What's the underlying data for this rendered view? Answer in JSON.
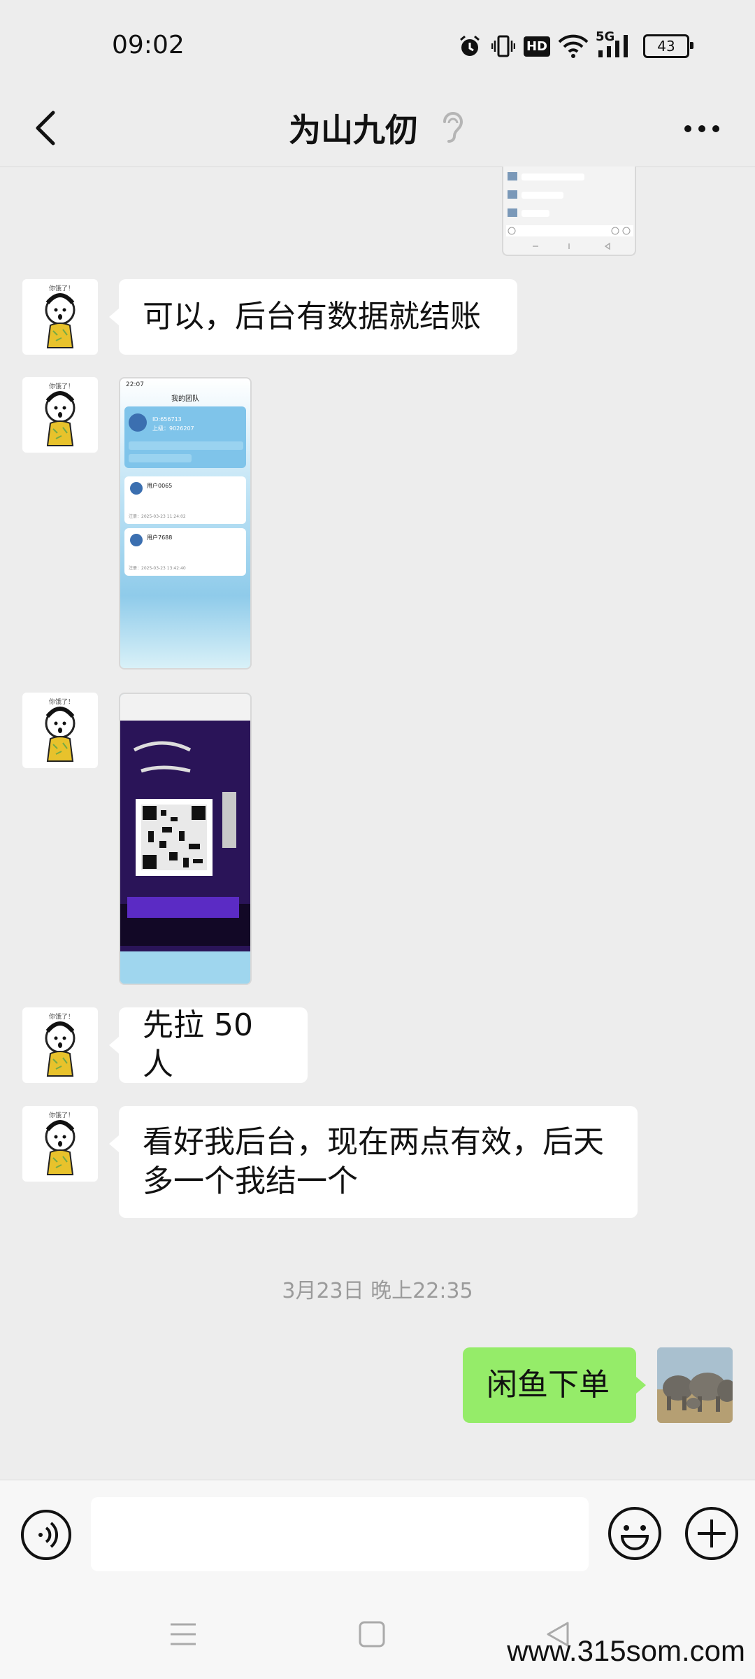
{
  "status_bar": {
    "time": "09:02",
    "network": "5G",
    "hd": "HD",
    "battery": "43",
    "icons": [
      "alarm-icon",
      "vibrate-icon",
      "hd-icon",
      "wifi-icon",
      "signal-icon",
      "battery-icon"
    ]
  },
  "header": {
    "title": "为山九仞",
    "back_icon": "chevron-left-icon",
    "muted_icon": "ear-icon",
    "more_icon": "more-dots-icon"
  },
  "messages": [
    {
      "side": "left",
      "type": "text",
      "text": "可以，后台有数据就结账"
    },
    {
      "side": "left",
      "type": "image",
      "content": "team-screenshot"
    },
    {
      "side": "left",
      "type": "image",
      "content": "qr-poster"
    },
    {
      "side": "left",
      "type": "text",
      "text": "先拉 50 人"
    },
    {
      "side": "left",
      "type": "text",
      "lines": [
        "看好我后台，现在两点有效，后天",
        "多一个我结一个"
      ]
    },
    {
      "side": "right",
      "type": "text",
      "text": "闲鱼下单"
    }
  ],
  "timestamp": "3月23日 晚上22:35",
  "team_screenshot": {
    "time": "22:07",
    "title": "我的团队",
    "user_id": "ID:656713",
    "superior": "上级：9026207",
    "members": [
      {
        "name": "用户0065",
        "date": "注册：2025-03-23 11:24:02"
      },
      {
        "name": "用户7688",
        "date": "注册：2025-03-23 13:42:40"
      }
    ]
  },
  "avatar_caption": "你饿了！",
  "colors": {
    "background": "#ededed",
    "my_bubble": "#95ec69",
    "their_bubble": "#ffffff"
  },
  "input_bar": {
    "voice_icon": "voice-icon",
    "emoji_icon": "emoji-icon",
    "plus_icon": "plus-icon"
  },
  "nav_bar": {
    "icons": [
      "menu-icon",
      "home-square-icon",
      "back-triangle-icon"
    ]
  },
  "watermark": "www.315som.com"
}
